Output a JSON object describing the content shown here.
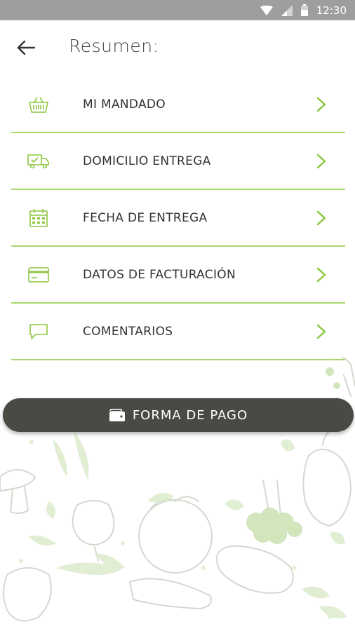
{
  "status_bar": {
    "time": "12:30"
  },
  "header": {
    "title": "Resumen:",
    "back_icon": "arrow-left-icon"
  },
  "menu": {
    "items": [
      {
        "label": "MI MANDADO",
        "icon": "basket-icon"
      },
      {
        "label": "DOMICILIO ENTREGA",
        "icon": "delivery-truck-icon"
      },
      {
        "label": "FECHA DE ENTREGA",
        "icon": "calendar-icon"
      },
      {
        "label": "DATOS DE FACTURACIÓN",
        "icon": "credit-card-icon"
      },
      {
        "label": "COMENTARIOS",
        "icon": "comment-icon"
      }
    ]
  },
  "payment_button": {
    "label": "FORMA DE PAGO",
    "icon": "wallet-icon"
  },
  "colors": {
    "accent": "#8cc63f",
    "divider": "#a9d86e",
    "button": "#4a4a44",
    "status_bar": "#9e9e9e"
  }
}
